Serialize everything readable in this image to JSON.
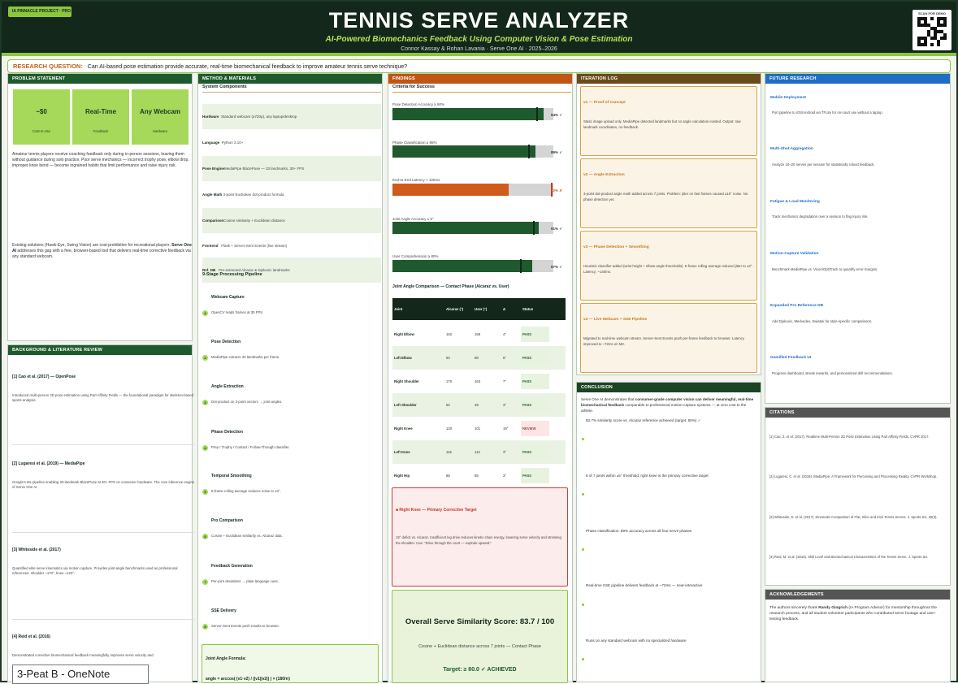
{
  "header": {
    "badge": "IA PINNACLE PROJECT · PRO",
    "title": "TENNIS SERVE ANALYZER",
    "subtitle": "AI-Powered Biomechanics Feedback Using Computer Vision & Pose Estimation",
    "authors": "Connor Kassay  &  Rohan Lavania   ·   Serve One AI   ·   2025–2026",
    "qr_label": "SCAN FOR DEMO"
  },
  "research_question": {
    "label": "RESEARCH QUESTION:",
    "text": "Can AI-based pose estimation provide accurate, real-time biomechanical feedback to improve amateur tennis serve technique?"
  },
  "problem": {
    "heading": "PROBLEM STATEMENT",
    "stats": [
      {
        "value": "~$0",
        "label": "Cost to Use"
      },
      {
        "value": "Real-Time",
        "label": "Feedback"
      },
      {
        "value": "Any Webcam",
        "label": "Hardware"
      }
    ],
    "para1": "Amateur tennis players receive coaching feedback only during in-person sessions, leaving them without guidance during solo practice. Poor serve mechanics — incorrect trophy pose, elbow drop, improper knee bend — become ingrained habits that limit performance and raise injury risk.",
    "para2_a": "Existing solutions (Hawk-Eye, Swing Vision) are cost-prohibitive for recreational players.",
    "para2_bold": "Serve One AI",
    "para2_b": "addresses this gap with a free, browser-based tool that delivers real-time corrective feedback via any standard webcam."
  },
  "background": {
    "heading": "BACKGROUND & LITERATURE REVIEW",
    "refs": [
      {
        "title": "[1] Cao et al. (2017) — OpenPose",
        "desc": "Introduced multi-person 2D pose estimation using Part Affinity Fields — the foundational paradigm for skeleton-based sports analysis."
      },
      {
        "title": "[2] Lugaresi et al. (2019) — MediaPipe",
        "desc": "Google's ML pipeline enabling 33-landmark BlazePose at 30+ FPS on consumer hardware. The core inference engine of Serve One AI."
      },
      {
        "title": "[3] Whiteside et al. (2017)",
        "desc": "Quantified elite serve kinematics via motion capture. Provides joint-angle benchmarks used as professional references: shoulder ~170°, knee ~120°."
      },
      {
        "title": "[4] Reid et al. (2016)",
        "desc": "Demonstrated corrective biomechanical feedback meaningfully improves serve velocity and"
      }
    ]
  },
  "methods": {
    "heading": "METHOD & MATERIALS",
    "components_heading": "System Components",
    "components": [
      {
        "name": "Hardware",
        "value": "Standard webcam (≥720p), any laptop/desktop"
      },
      {
        "name": "Language",
        "value": "Python 3.10+"
      },
      {
        "name": "Pose Engine",
        "value": "MediaPipe BlazePose — 33 landmarks, 30+ FPS"
      },
      {
        "name": "Angle Math",
        "value": "3-point Euclidean dot-product formula"
      },
      {
        "name": "Comparison",
        "value": "Cosine similarity + Euclidean distance"
      },
      {
        "name": "Frontend",
        "value": "Flask + Server-Sent Events (live stream)"
      },
      {
        "name": "Ref. DB",
        "value": "Pre-extracted Alcaraz & Djokovic landmarks"
      }
    ],
    "pipeline_heading": "9-Stage Processing Pipeline",
    "steps": [
      {
        "num": "1",
        "title": "Webcam Capture",
        "desc": "OpenCV reads frames at 30 FPS."
      },
      {
        "num": "2",
        "title": "Pose Detection",
        "desc": "MediaPipe extracts 33 landmarks per frame."
      },
      {
        "num": "3",
        "title": "Angle Extraction",
        "desc": "Dot-product on 3-point vectors → joint angles."
      },
      {
        "num": "4",
        "title": "Phase Detection",
        "desc": "Prep / Trophy / Contact / Follow-Through classifier."
      },
      {
        "num": "5",
        "title": "Temporal Smoothing",
        "desc": "5-frame rolling average reduces noise to ±3°."
      },
      {
        "num": "6",
        "title": "Pro Comparison",
        "desc": "Cosine + Euclidean similarity vs. Alcaraz data."
      },
      {
        "num": "7",
        "title": "Feedback Generation",
        "desc": "Per-joint deviations → plain-language cues."
      },
      {
        "num": "8",
        "title": "SSE Delivery",
        "desc": "Server-Sent Events push results to browser."
      }
    ],
    "formula_title": "Joint Angle Formula:",
    "formula": "angle = arccos( (v1·v2) / (|v1||v2|) ) × (180/π)"
  },
  "findings": {
    "heading": "FINDINGS",
    "criteria_heading": "Criteria for Success",
    "metrics": [
      {
        "label": "Pose Detection Accuracy ≥ 90%",
        "value": 94,
        "target": 90,
        "display": "94% ✓",
        "met": true
      },
      {
        "label": "Phase Classification ≥ 85%",
        "value": 89,
        "target": 85,
        "display": "89% ✓",
        "met": true
      },
      {
        "label": "End-to-End Latency < 100ms",
        "value": 72,
        "target": 100,
        "display": "72% ✗",
        "met": false
      },
      {
        "label": "Joint Angle Accuracy ± 5°",
        "value": 91,
        "target": 88,
        "display": "91% ✓",
        "met": true
      },
      {
        "label": "User Comprehension ≥ 80%",
        "value": 87,
        "target": 80,
        "display": "87% ✓",
        "met": true
      }
    ],
    "table_heading": "Joint Angle Comparison — Contact Phase (Alcaraz vs. User)",
    "table_columns": [
      "Joint",
      "Alcaraz (°)",
      "User (°)",
      "Δ",
      "Status"
    ],
    "table_rows": [
      {
        "joint": "Right Elbow",
        "alcaraz": "162",
        "user": "158",
        "delta": "4°",
        "status": "PASS"
      },
      {
        "joint": "Left Elbow",
        "alcaraz": "94",
        "user": "88",
        "delta": "6°",
        "status": "PASS"
      },
      {
        "joint": "Right Shoulder",
        "alcaraz": "170",
        "user": "163",
        "delta": "7°",
        "status": "PASS"
      },
      {
        "joint": "Left Shoulder",
        "alcaraz": "52",
        "user": "49",
        "delta": "3°",
        "status": "PASS"
      },
      {
        "joint": "Right Knee",
        "alcaraz": "120",
        "user": "101",
        "delta": "19°",
        "status": "REVIEW"
      },
      {
        "joint": "Left Knee",
        "alcaraz": "115",
        "user": "112",
        "delta": "3°",
        "status": "PASS"
      },
      {
        "joint": "Right Hip",
        "alcaraz": "88",
        "user": "85",
        "delta": "3°",
        "status": "PASS"
      }
    ],
    "alert_title": "■  Right Knee — Primary Corrective Target",
    "alert_text": "19° deficit vs. Alcaraz. Insufficient leg drive reduces kinetic-chain energy, lowering serve velocity and stressing the shoulder. Cue: \"Drive through the court — explode upward.\"",
    "score_title": "Overall Serve Similarity Score:  83.7 / 100",
    "score_sub": "Cosine + Euclidean distance across 7 joints — Contact Phase",
    "score_target": "Target: ≥ 80.0  ✓  ACHIEVED"
  },
  "iteration": {
    "heading": "ITERATION LOG",
    "items": [
      {
        "title": "v1 — Proof of Concept",
        "desc": "Static image upload only. MediaPipe detected landmarks but no angle calculation existed. Output: raw landmark coordinates, no feedback."
      },
      {
        "title": "v2 — Angle Extraction",
        "desc": "3-point dot-product angle math added across 7 joints. Problem: jitter on fast frames caused ±15° noise. No phase detection yet."
      },
      {
        "title": "v3 — Phase Detection + Smoothing",
        "desc": "Heuristic classifier added (wrist height + elbow angle thresholds). 5-frame rolling average reduced jitter to ±3°. Latency: ~140ms."
      },
      {
        "title": "v4 — Live Webcam + SSE Pipeline",
        "desc": "Migrated to real-time webcam stream. Server-Sent Events push per-frame feedback to browser. Latency improved to ~72ms on M2."
      }
    ]
  },
  "conclusion": {
    "heading": "CONCLUSION",
    "intro_a": "Serve One AI demonstrates that",
    "intro_bold": "consumer-grade computer vision can deliver meaningful, real-time biomechanical feedback",
    "intro_b": "comparable to professional motion-capture systems — at zero cost to the athlete.",
    "points": [
      "83.7% similarity score vs. Alcaraz reference achieved (target: 80%) ✓",
      "6 of 7 joints within ±5° threshold; right knee is the primary corrective target",
      "Phase classification: 89% accuracy across all four serve phases",
      "Real-time SSE pipeline delivers feedback at ~72ms — near-interactive",
      "Runs on any standard webcam with no specialized hardware"
    ]
  },
  "future": {
    "heading": "FUTURE RESEARCH",
    "items": [
      {
        "title": "Mobile Deployment",
        "desc": "Port pipeline to iOS/Android via TFLite for on-court use without a laptop."
      },
      {
        "title": "Multi-Shot Aggregation",
        "desc": "Analyze 10–20 serves per session for statistically robust feedback."
      },
      {
        "title": "Fatigue & Load Monitoring",
        "desc": "Track mechanics degradation over a session to flag injury risk."
      },
      {
        "title": "Motion-Capture Validation",
        "desc": "Benchmark MediaPipe vs. Vicon/OptiTrack to quantify error margins."
      },
      {
        "title": "Expanded Pro Reference DB",
        "desc": "Add Djokovic, Medvedev, Swiatek for style-specific comparisons."
      },
      {
        "title": "Gamified Feedback UI",
        "desc": "Progress dashboard, streak rewards, and personalized drill recommendations."
      }
    ]
  },
  "citations": {
    "heading": "CITATIONS",
    "items": [
      "[1] Cao, Z. et al. (2017). Realtime Multi-Person 2D Pose Estimation Using Part Affinity Fields. CVPR 2017.",
      "[2] Lugaresi, C. et al. (2019). MediaPipe: A Framework for Perceiving and Processing Reality. CVPR Workshop.",
      "[3] Whiteside, D. et al. (2017). Kinematic Comparison of Flat, Slice and Kick Tennis Serves. J. Sports Sci, 35(3).",
      "[4] Reid, M. et al. (2016). Skill Level and Biomechanical Characteristics of the Tennis Serve. J. Sports Sci."
    ]
  },
  "acknowledgements": {
    "heading": "ACKNOWLEDGEMENTS",
    "text_a": "The authors sincerely thank",
    "text_bold": "Randy Gingrich",
    "text_b": "(IA Program Advisor) for mentorship throughout the research process, and all student volunteer participants who contributed serve footage and user-testing feedback."
  },
  "toast": {
    "text": "3-Peat B - OneNote"
  },
  "colors": {
    "dark_green": "#13271a",
    "lime": "#8cc63f",
    "bar_green": "#1e5a2e",
    "miss_orange": "#d05a1a",
    "accent_blue": "#1f6dc6"
  }
}
